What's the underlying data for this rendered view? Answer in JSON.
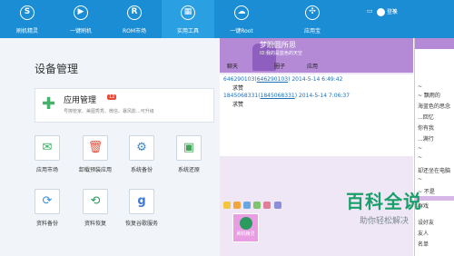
{
  "nav": {
    "items": [
      {
        "label": "刷机精灵",
        "glyph": "S"
      },
      {
        "label": "一键刷机",
        "glyph": "▶"
      },
      {
        "label": "ROM市场",
        "glyph": "R"
      },
      {
        "label": "实用工具",
        "glyph": "▦"
      }
    ],
    "extra_tabs": [
      {
        "label": "一键Root",
        "glyph": "☁"
      },
      {
        "label": "应用宝",
        "glyph": "✣"
      }
    ],
    "login_label": "登录"
  },
  "main": {
    "title": "设备管理",
    "card": {
      "title": "应用管理",
      "badge": "12",
      "desc": "号擦管家、美图秀秀、微信、暴风影...可升级"
    },
    "tools": [
      {
        "label": "应用市场",
        "glyph": "✉",
        "color": "#2fae5e"
      },
      {
        "label": "卸载预装应用",
        "glyph": "🗑",
        "color": "#e05240"
      },
      {
        "label": "系统备份",
        "glyph": "⚙",
        "color": "#3c87c9"
      },
      {
        "label": "系统还原",
        "glyph": "▣",
        "color": "#42a458"
      },
      {
        "label": "资料备份",
        "glyph": "⟳",
        "color": "#3b8fd6"
      },
      {
        "label": "资料恢复",
        "glyph": "⟲",
        "color": "#2a9a56"
      },
      {
        "label": "恢复谷歌服务",
        "glyph": "g",
        "color": "#3f79d6"
      }
    ]
  },
  "chat": {
    "title": "梦盼圆所思",
    "subtitle": "ID:我的是蓝色的天空",
    "toolbar": [
      "聊天",
      "圈子",
      "应用"
    ],
    "messages": [
      {
        "sender": "646290103",
        "sender_paren": "646290103",
        "time": "2014-5-14 6:49:42",
        "text": "求赞"
      },
      {
        "sender": "1845068331",
        "sender_paren": "1845068331",
        "time": "2014-5-14 7:06:37",
        "text": "求赞"
      }
    ],
    "chip_label": "刷机精灵"
  },
  "side_panel": {
    "lines": [
      "~ ",
      "~ 飘雨的",
      "海蓝色的思念",
      "...回忆",
      "你有我",
      "...满行",
      "~ ",
      "~ ",
      "却还坐在电脑",
      "~ ",
      "~ 不是",
      "群戏",
      "设好友",
      "友人",
      "名单"
    ]
  },
  "watermark": {
    "title": "百科全说",
    "subtitle": "助你轻松解决"
  }
}
